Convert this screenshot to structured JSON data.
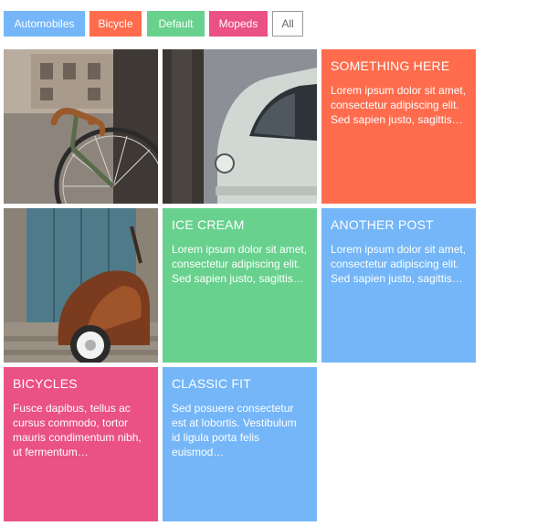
{
  "colors": {
    "blue": "#74b6f8",
    "orange": "#fe6c4d",
    "green": "#68d18e",
    "pink": "#ea5184"
  },
  "filters": [
    {
      "label": "Automobiles",
      "color": "#74b6f8"
    },
    {
      "label": "Bicycle",
      "color": "#fe6c4d"
    },
    {
      "label": "Default",
      "color": "#68d18e"
    },
    {
      "label": "Mopeds",
      "color": "#ea5184"
    },
    {
      "label": "All",
      "color": "#ffffff"
    }
  ],
  "tiles": {
    "something_here": {
      "title": "SOMETHING HERE",
      "body": "Lorem ipsum dolor sit amet, consectetur adipiscing elit. Sed sapien justo, sagittis…"
    },
    "ice_cream": {
      "title": "ICE CREAM",
      "body": "Lorem ipsum dolor sit amet, consectetur adipiscing elit. Sed sapien justo, sagittis…"
    },
    "another_post": {
      "title": "ANOTHER POST",
      "body": "Lorem ipsum dolor sit amet, consectetur adipiscing elit. Sed sapien justo, sagittis…"
    },
    "bicycles": {
      "title": "BICYCLES",
      "body": "Fusce dapibus, tellus ac cursus commodo, tortor mauris condimentum nibh, ut fermentum…"
    },
    "classic_fit": {
      "title": "CLASSIC FIT",
      "body": "Sed posuere consectetur est at lobortis. Vestibulum id ligula porta felis euismod…"
    }
  }
}
